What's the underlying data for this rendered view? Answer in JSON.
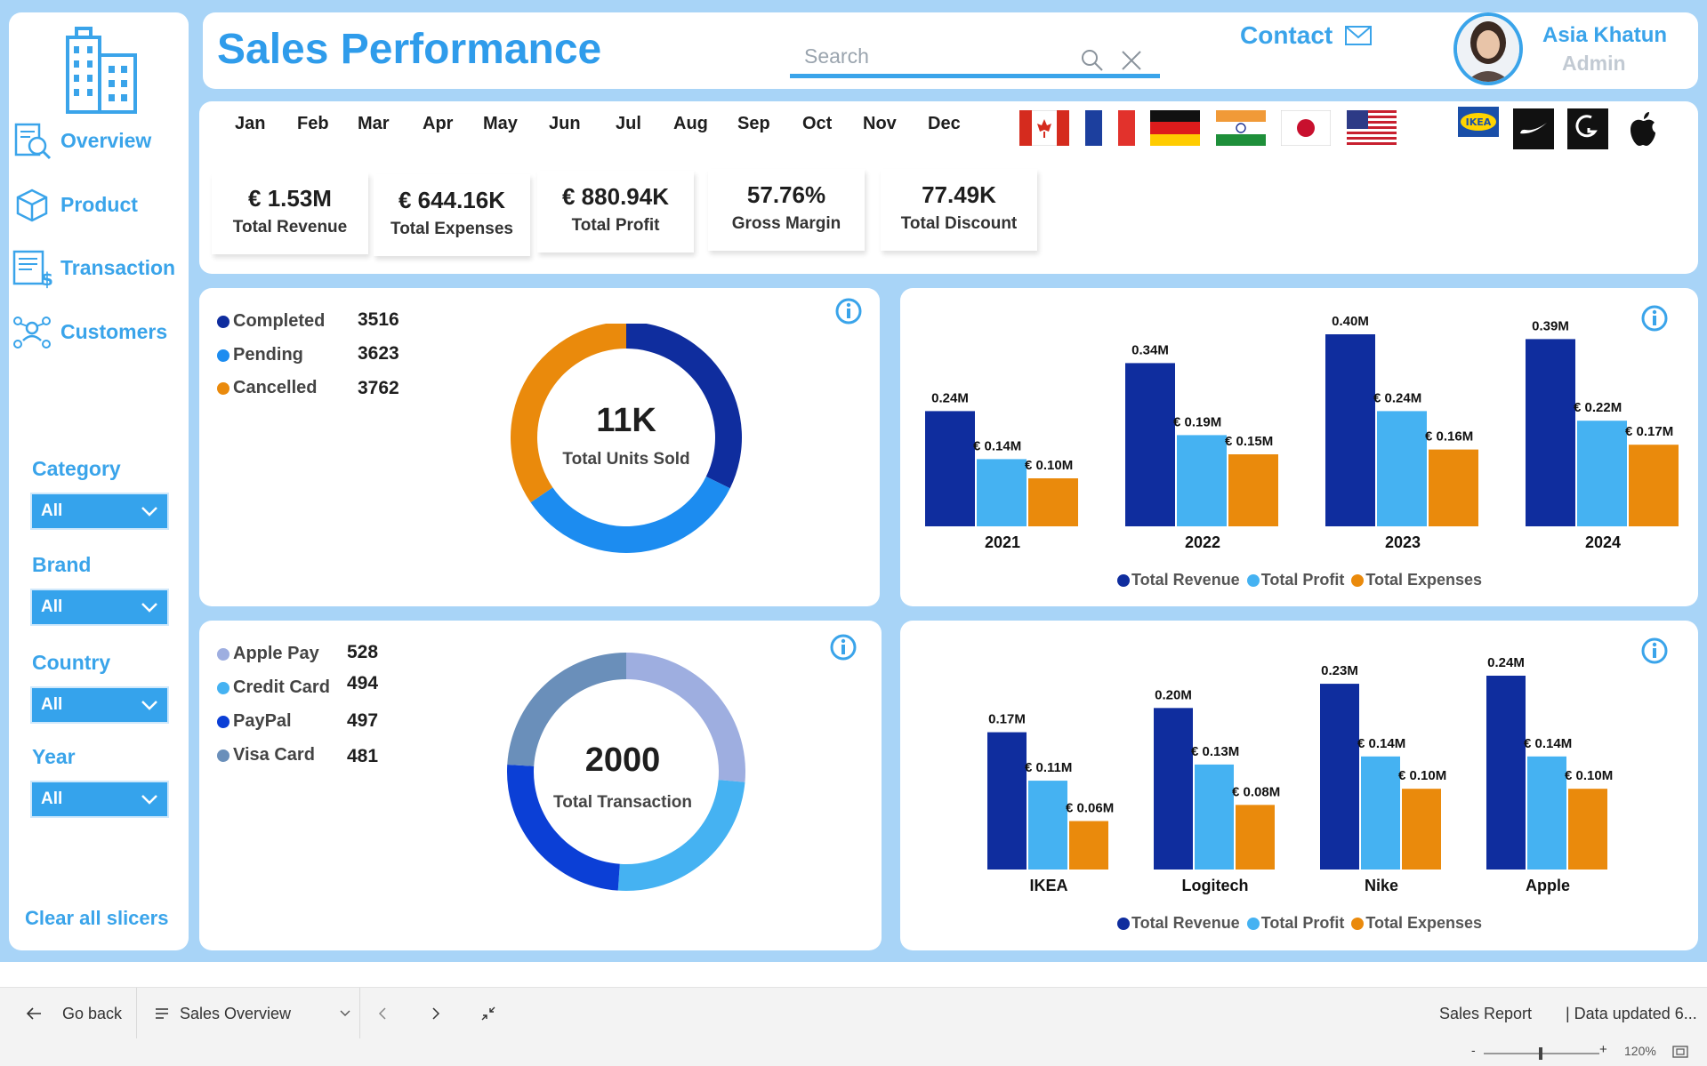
{
  "header": {
    "title": "Sales Performance",
    "search_placeholder": "Search",
    "contact_label": "Contact",
    "user_name": "Asia Khatun",
    "user_role": "Admin"
  },
  "sidebar": {
    "nav": [
      {
        "label": "Overview",
        "icon": "overview-icon"
      },
      {
        "label": "Product",
        "icon": "product-icon"
      },
      {
        "label": "Transaction",
        "icon": "transaction-icon"
      },
      {
        "label": "Customers",
        "icon": "customers-icon"
      }
    ],
    "filters": [
      {
        "title": "Category",
        "value": "All"
      },
      {
        "title": "Brand",
        "value": "All"
      },
      {
        "title": "Country",
        "value": "All"
      },
      {
        "title": "Year",
        "value": "All"
      }
    ],
    "clear_label": "Clear all slicers"
  },
  "months": [
    "Jan",
    "Feb",
    "Mar",
    "Apr",
    "May",
    "Jun",
    "Jul",
    "Aug",
    "Sep",
    "Oct",
    "Nov",
    "Dec"
  ],
  "flags": [
    "canada-flag",
    "france-flag",
    "germany-flag",
    "india-flag",
    "japan-flag",
    "usa-flag"
  ],
  "brand_logos": [
    "ikea-logo",
    "nike-logo",
    "logitech-logo",
    "apple-logo"
  ],
  "kpis": [
    {
      "value": "€ 1.53M",
      "label": "Total Revenue"
    },
    {
      "value": "€ 644.16K",
      "label": "Total Expenses"
    },
    {
      "value": "€ 880.94K",
      "label": "Total Profit"
    },
    {
      "value": "57.76%",
      "label": "Gross Margin"
    },
    {
      "value": "77.49K",
      "label": "Total Discount"
    }
  ],
  "status_donut": {
    "center_value": "11K",
    "center_label": "Total Units Sold",
    "colors": {
      "Completed": "#0f2d9e",
      "Pending": "#1c8cf0",
      "Cancelled": "#ea8a0c"
    }
  },
  "payment_donut": {
    "center_value": "2000",
    "center_label": "Total Transaction",
    "colors": {
      "Apple Pay": "#9eaee0",
      "Credit Card": "#45b2f2",
      "PayPal": "#0b3fd6",
      "Visa Card": "#6a8fba"
    }
  },
  "bar_legend": {
    "revenue": "Total Revenue",
    "profit": "Total Profit",
    "expenses": "Total Expenses",
    "colors": {
      "revenue": "#0f2d9e",
      "profit": "#45b2f2",
      "expenses": "#ea8a0c"
    }
  },
  "appbar": {
    "back_label": "Go back",
    "page_label": "Sales Overview",
    "report_label": "Sales Report",
    "updated_label": "| Data updated 6...",
    "zoom_label": "120%"
  },
  "chart_data": [
    {
      "type": "pie",
      "subtype": "donut",
      "categories": [
        "Completed",
        "Pending",
        "Cancelled"
      ],
      "values": [
        3516,
        3623,
        3762
      ],
      "center_text": "11K",
      "center_label": "Total Units Sold"
    },
    {
      "type": "bar",
      "categories": [
        "2021",
        "2022",
        "2023",
        "2024"
      ],
      "series": [
        {
          "name": "Total Revenue",
          "values": [
            0.24,
            0.34,
            0.4,
            0.39
          ],
          "labels": [
            "0.24M",
            "0.34M",
            "0.40M",
            "0.39M"
          ]
        },
        {
          "name": "Total Profit",
          "values": [
            0.14,
            0.19,
            0.24,
            0.22
          ],
          "labels": [
            "€ 0.14M",
            "€ 0.19M",
            "€ 0.24M",
            "€ 0.22M"
          ]
        },
        {
          "name": "Total Expenses",
          "values": [
            0.1,
            0.15,
            0.16,
            0.17
          ],
          "labels": [
            "€ 0.10M",
            "€ 0.15M",
            "€ 0.16M",
            "€ 0.17M"
          ]
        }
      ],
      "ylim": [
        0,
        0.4
      ],
      "legend": "bottom"
    },
    {
      "type": "pie",
      "subtype": "donut",
      "categories": [
        "Apple Pay",
        "Credit Card",
        "PayPal",
        "Visa Card"
      ],
      "values": [
        528,
        494,
        497,
        481
      ],
      "center_text": "2000",
      "center_label": "Total Transaction"
    },
    {
      "type": "bar",
      "categories": [
        "IKEA",
        "Logitech",
        "Nike",
        "Apple"
      ],
      "series": [
        {
          "name": "Total Revenue",
          "values": [
            0.17,
            0.2,
            0.23,
            0.24
          ],
          "labels": [
            "0.17M",
            "0.20M",
            "0.23M",
            "0.24M"
          ]
        },
        {
          "name": "Total Profit",
          "values": [
            0.11,
            0.13,
            0.14,
            0.14
          ],
          "labels": [
            "€ 0.11M",
            "€ 0.13M",
            "€ 0.14M",
            "€ 0.14M"
          ]
        },
        {
          "name": "Total Expenses",
          "values": [
            0.06,
            0.08,
            0.1,
            0.1
          ],
          "labels": [
            "€ 0.06M",
            "€ 0.08M",
            "€ 0.10M",
            "€ 0.10M"
          ]
        }
      ],
      "ylim": [
        0,
        0.24
      ],
      "legend": "bottom"
    }
  ]
}
